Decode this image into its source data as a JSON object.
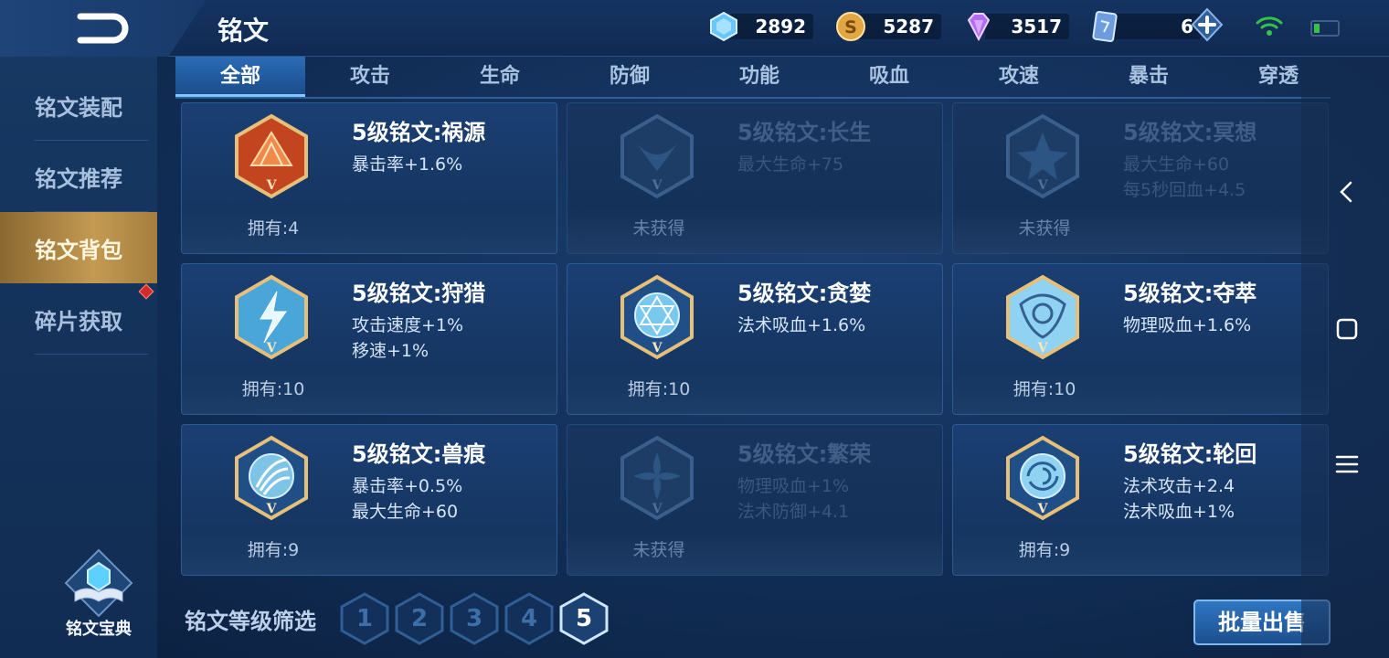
{
  "header": {
    "title": "铭文",
    "currencies": [
      {
        "name": "crystal",
        "value": "2892"
      },
      {
        "name": "gold-coin",
        "value": "5287"
      },
      {
        "name": "diamond",
        "value": "3517"
      },
      {
        "name": "card",
        "value": "6"
      }
    ]
  },
  "sidebar": {
    "items": [
      {
        "label": "铭文装配"
      },
      {
        "label": "铭文推荐"
      },
      {
        "label": "铭文背包"
      },
      {
        "label": "碎片获取"
      }
    ],
    "active_index": 2,
    "codex_label": "铭文宝典"
  },
  "tabs": {
    "items": [
      "全部",
      "攻击",
      "生命",
      "防御",
      "功能",
      "吸血",
      "攻速",
      "暴击",
      "穿透"
    ],
    "active_index": 0
  },
  "cards": [
    {
      "name": "5级铭文:祸源",
      "stats": [
        "暴击率+1.6%"
      ],
      "owned": "拥有:4",
      "locked": false,
      "icon": "red-fan-emblem"
    },
    {
      "name": "5级铭文:长生",
      "stats": [
        "最大生命+75"
      ],
      "owned": "未获得",
      "locked": true,
      "icon": "whale-tail-emblem"
    },
    {
      "name": "5级铭文:冥想",
      "stats": [
        "最大生命+60",
        "每5秒回血+4.5"
      ],
      "owned": "未获得",
      "locked": true,
      "icon": "star-emblem"
    },
    {
      "name": "5级铭文:狩猎",
      "stats": [
        "攻击速度+1%",
        "移速+1%"
      ],
      "owned": "拥有:10",
      "locked": false,
      "icon": "lightning-emblem"
    },
    {
      "name": "5级铭文:贪婪",
      "stats": [
        "法术吸血+1.6%"
      ],
      "owned": "拥有:10",
      "locked": false,
      "icon": "hexagram-emblem"
    },
    {
      "name": "5级铭文:夺萃",
      "stats": [
        "物理吸血+1.6%"
      ],
      "owned": "拥有:10",
      "locked": false,
      "icon": "knot-emblem"
    },
    {
      "name": "5级铭文:兽痕",
      "stats": [
        "暴击率+0.5%",
        "最大生命+60"
      ],
      "owned": "拥有:9",
      "locked": false,
      "icon": "claw-emblem"
    },
    {
      "name": "5级铭文:繁荣",
      "stats": [
        "物理吸血+1%",
        "法术防御+4.1"
      ],
      "owned": "未获得",
      "locked": true,
      "icon": "flower-emblem"
    },
    {
      "name": "5级铭文:轮回",
      "stats": [
        "法术攻击+2.4",
        "法术吸血+1%"
      ],
      "owned": "拥有:9",
      "locked": false,
      "icon": "swirl-emblem"
    }
  ],
  "filter": {
    "label": "铭文等级筛选",
    "levels": [
      "1",
      "2",
      "3",
      "4",
      "5"
    ],
    "active_index": 4
  },
  "sell_button": "批量出售",
  "colors": {
    "background": "#12305a",
    "accent_gold": "#c49a52",
    "tab_active": "#2b6cb6",
    "locked_text": "#3f5f88"
  }
}
